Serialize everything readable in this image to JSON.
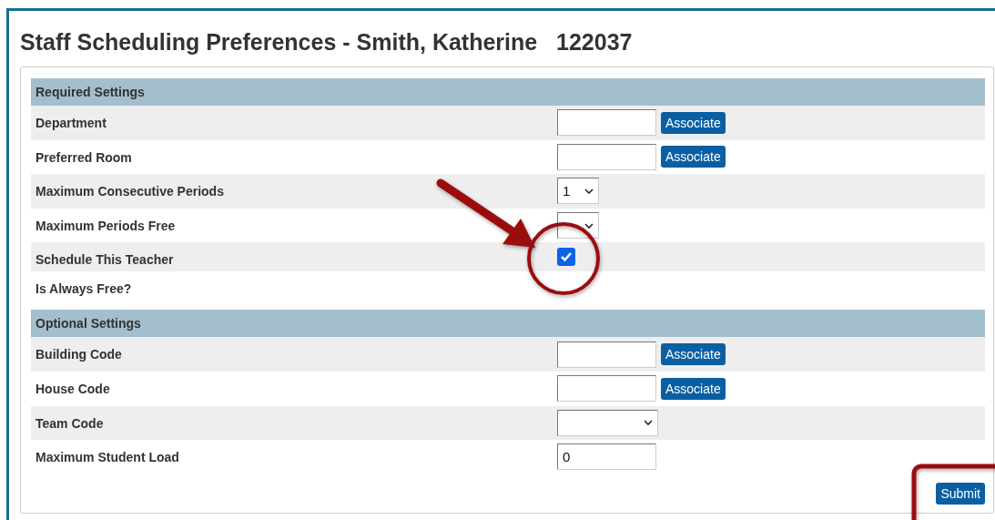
{
  "title": "Staff Scheduling Preferences - Smith, Katherine   122037",
  "sections": [
    {
      "heading": "Required Settings",
      "rows": [
        {
          "label": "Department",
          "kind": "associate",
          "button": "Associate"
        },
        {
          "label": "Preferred Room",
          "kind": "associate",
          "button": "Associate"
        },
        {
          "label": "Maximum Consecutive Periods",
          "kind": "select",
          "value": "1"
        },
        {
          "label": "Maximum Periods Free",
          "kind": "select"
        },
        {
          "label": "Schedule This Teacher",
          "kind": "checkbox",
          "checked": true
        },
        {
          "label": "Is Always Free?",
          "kind": "none"
        }
      ]
    },
    {
      "heading": "Optional Settings",
      "rows": [
        {
          "label": "Building Code",
          "kind": "associate",
          "button": "Associate"
        },
        {
          "label": "House Code",
          "kind": "associate",
          "button": "Associate"
        },
        {
          "label": "Team Code",
          "kind": "wideselect"
        },
        {
          "label": "Maximum Student Load",
          "kind": "text",
          "value": "0"
        }
      ]
    }
  ],
  "submit": "Submit"
}
